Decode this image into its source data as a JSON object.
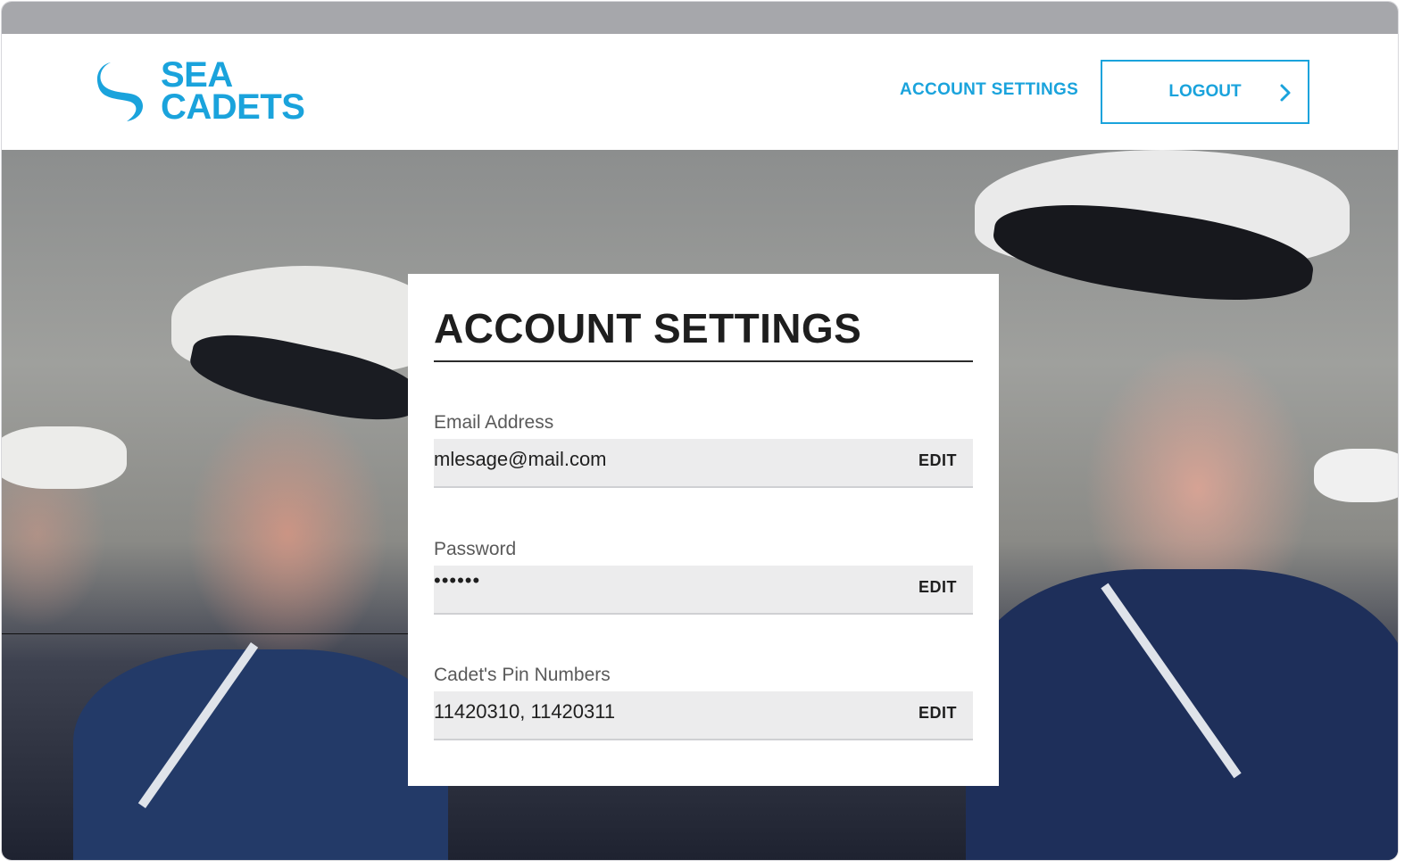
{
  "brand": {
    "logo_line1": "SEA",
    "logo_line2": "CADETS",
    "accent_color": "#1aa3dc"
  },
  "header": {
    "nav_account_settings": "ACCOUNT SETTINGS",
    "logout_label": "LOGOUT",
    "logout_icon": "chevron-right-icon"
  },
  "card": {
    "title": "ACCOUNT SETTINGS",
    "fields": [
      {
        "label": "Email Address",
        "value": "mlesage@mail.com",
        "action": "EDIT"
      },
      {
        "label": "Password",
        "value": "••••••",
        "action": "EDIT"
      },
      {
        "label": "Cadet's Pin Numbers",
        "value": "11420310, 11420311",
        "action": "EDIT"
      }
    ]
  }
}
